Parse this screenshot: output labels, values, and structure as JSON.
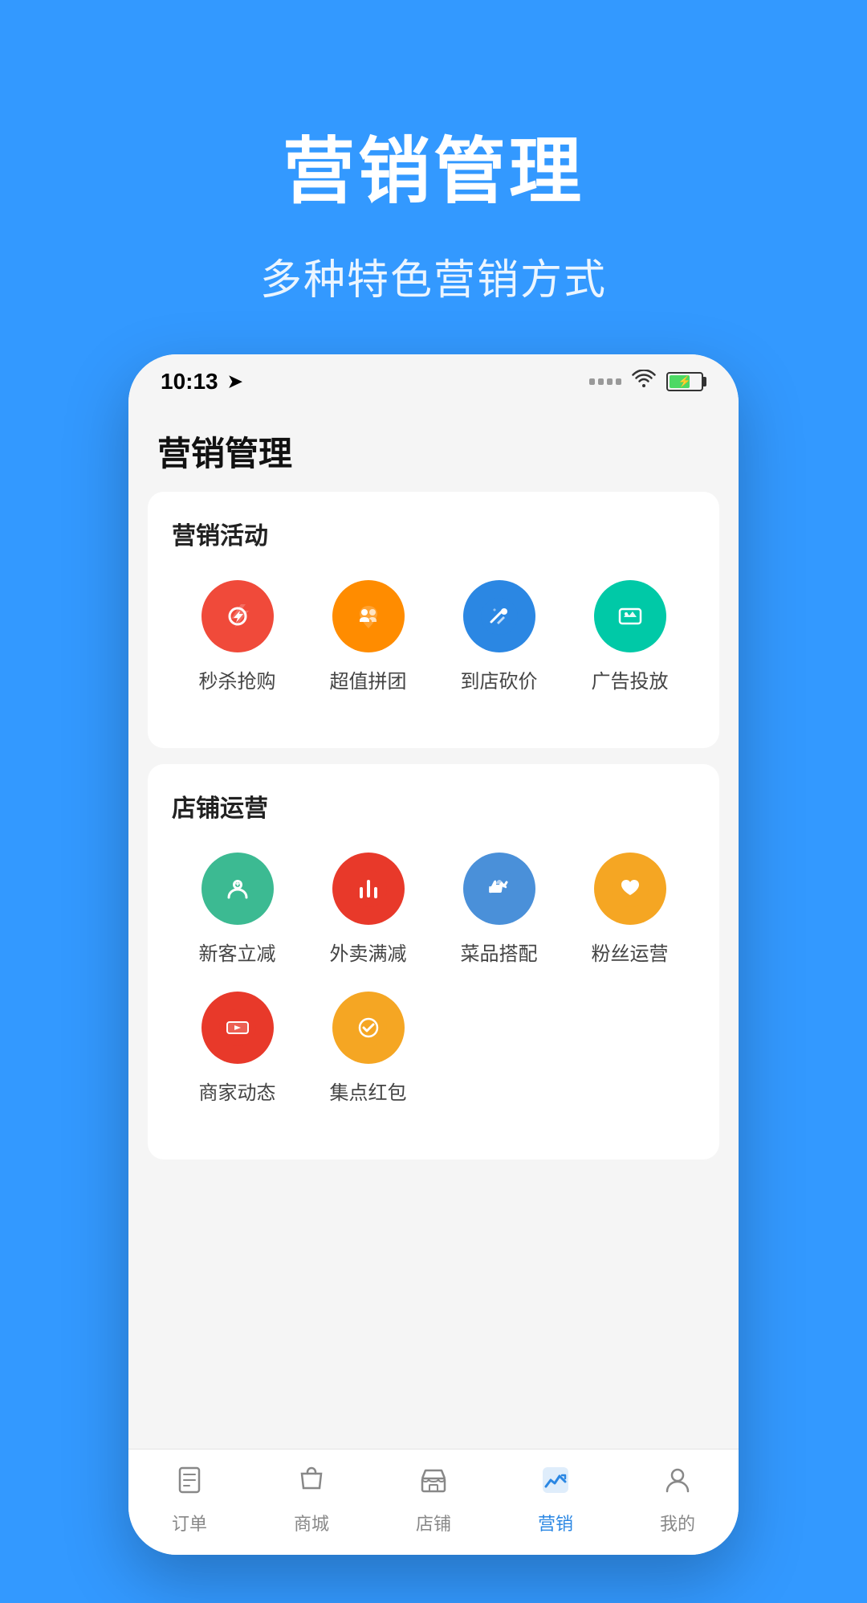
{
  "background_color": "#3399ff",
  "header": {
    "title": "营销管理",
    "subtitle": "多种特色营销方式"
  },
  "status_bar": {
    "time": "10:13",
    "signal": "···· ",
    "wifi": "wifi",
    "battery": "70"
  },
  "app": {
    "title": "营销管理",
    "sections": [
      {
        "id": "marketing-activities",
        "title": "营销活动",
        "items": [
          {
            "id": "flash-sale",
            "label": "秒杀抢购",
            "color": "#f04a3a",
            "icon": "flash"
          },
          {
            "id": "group-buy",
            "label": "超值拼团",
            "color": "#ff8c00",
            "icon": "puzzle"
          },
          {
            "id": "price-cut",
            "label": "到店砍价",
            "color": "#2b87e3",
            "icon": "tag"
          },
          {
            "id": "ad-placement",
            "label": "广告投放",
            "color": "#00c9a7",
            "icon": "chat"
          }
        ]
      },
      {
        "id": "store-operations",
        "title": "店铺运营",
        "items": [
          {
            "id": "new-customer",
            "label": "新客立减",
            "color": "#3cba92",
            "icon": "person"
          },
          {
            "id": "delivery-discount",
            "label": "外卖满减",
            "color": "#e8392a",
            "icon": "cutlery"
          },
          {
            "id": "menu-combo",
            "label": "菜品搭配",
            "color": "#4a90d9",
            "icon": "thumbup"
          },
          {
            "id": "fans-ops",
            "label": "粉丝运营",
            "color": "#f5a623",
            "icon": "heart"
          },
          {
            "id": "merchant-news",
            "label": "商家动态",
            "color": "#e8392a",
            "icon": "video"
          },
          {
            "id": "stamp-redpack",
            "label": "集点红包",
            "color": "#f5a623",
            "icon": "check-circle"
          }
        ]
      }
    ]
  },
  "bottom_nav": {
    "items": [
      {
        "id": "orders",
        "label": "订单",
        "active": false,
        "icon": "order"
      },
      {
        "id": "mall",
        "label": "商城",
        "active": false,
        "icon": "shop"
      },
      {
        "id": "store",
        "label": "店铺",
        "active": false,
        "icon": "store"
      },
      {
        "id": "marketing",
        "label": "营销",
        "active": true,
        "icon": "chart"
      },
      {
        "id": "mine",
        "label": "我的",
        "active": false,
        "icon": "person"
      }
    ]
  }
}
